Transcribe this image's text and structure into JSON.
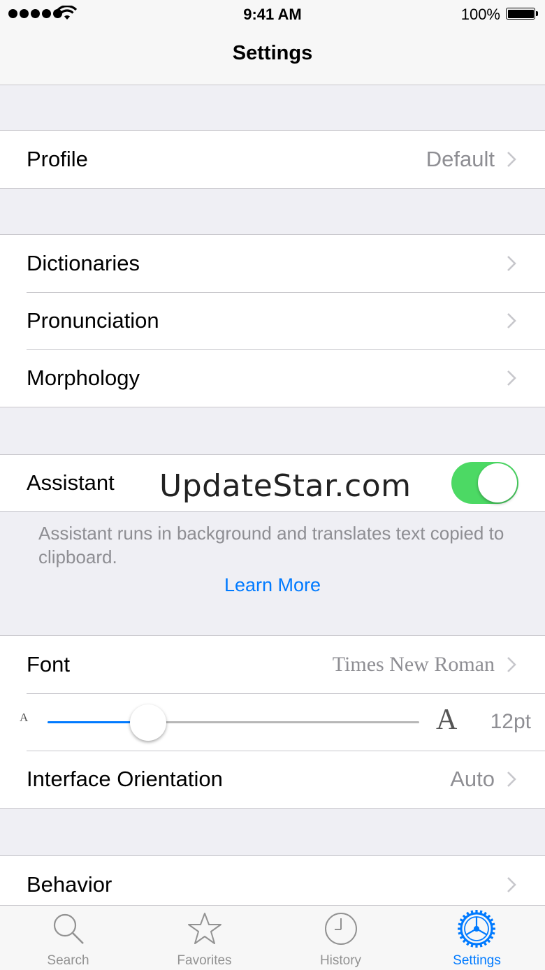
{
  "status_bar": {
    "time": "9:41 AM",
    "battery_percent": "100%",
    "icons": [
      "signal-dots-icon",
      "wifi-icon",
      "battery-icon"
    ]
  },
  "nav": {
    "title": "Settings"
  },
  "groups": {
    "profile": {
      "label": "Profile",
      "value": "Default"
    },
    "dictionaries": {
      "label": "Dictionaries"
    },
    "pronunciation": {
      "label": "Pronunciation"
    },
    "morphology": {
      "label": "Morphology"
    },
    "assistant": {
      "label": "Assistant",
      "enabled": true,
      "footer": "Assistant runs in background and translates text copied to clipboard.",
      "learn_more": "Learn More"
    },
    "font": {
      "label": "Font",
      "value": "Times New Roman"
    },
    "font_size": {
      "small_label": "A",
      "large_label": "A",
      "value": "12pt",
      "fraction": 0.27
    },
    "orientation": {
      "label": "Interface Orientation",
      "value": "Auto"
    },
    "behavior": {
      "label": "Behavior"
    }
  },
  "watermark": "UpdateStar.com",
  "tabs": [
    {
      "label": "Search",
      "icon": "search-icon",
      "active": false
    },
    {
      "label": "Favorites",
      "icon": "star-icon",
      "active": false
    },
    {
      "label": "History",
      "icon": "clock-icon",
      "active": false
    },
    {
      "label": "Settings",
      "icon": "gear-icon",
      "active": true
    }
  ],
  "colors": {
    "accent": "#007aff",
    "toggle_on": "#4cd964",
    "secondary_text": "#8e8e93",
    "background": "#efeff4"
  }
}
